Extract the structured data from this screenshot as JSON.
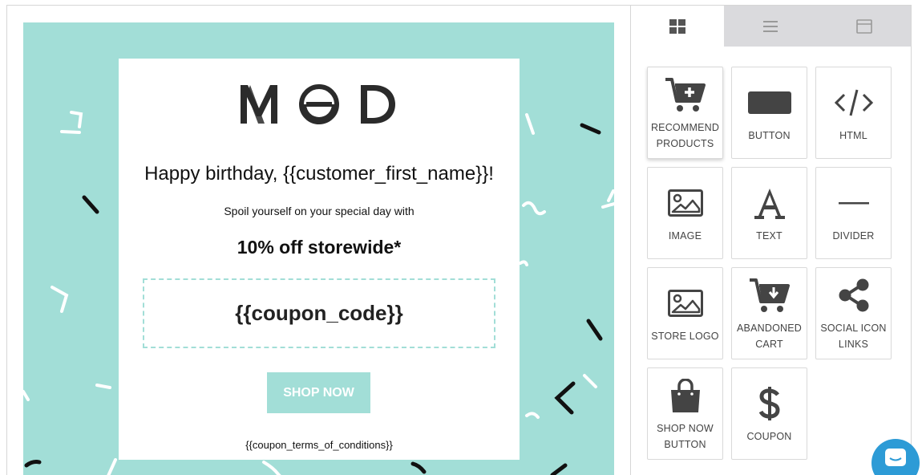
{
  "email": {
    "logo_text": "MOD",
    "headline": "Happy birthday, {{customer_first_name}}!",
    "subtext": "Spoil yourself on your special day with",
    "offer": "10% off storewide*",
    "coupon_code": "{{coupon_code}}",
    "shop_button": "SHOP NOW",
    "terms": "{{coupon_terms_of_conditions}}"
  },
  "colors": {
    "accent": "#a2ded7",
    "tab_inactive": "#dadadd",
    "icon": "#444444",
    "chat": "#2d9bd6"
  },
  "panel": {
    "tabs": [
      {
        "icon": "grid-icon"
      },
      {
        "icon": "list-icon"
      },
      {
        "icon": "layout-icon"
      }
    ],
    "blocks": [
      {
        "label": "RECOMMEND PRODUCTS",
        "icon": "cart-plus-icon"
      },
      {
        "label": "BUTTON",
        "icon": "button-icon"
      },
      {
        "label": "HTML",
        "icon": "code-icon"
      },
      {
        "label": "IMAGE",
        "icon": "image-icon"
      },
      {
        "label": "TEXT",
        "icon": "text-icon"
      },
      {
        "label": "DIVIDER",
        "icon": "divider-icon"
      },
      {
        "label": "STORE LOGO",
        "icon": "image-icon"
      },
      {
        "label": "ABANDONED CART",
        "icon": "cart-download-icon"
      },
      {
        "label": "SOCIAL ICON LINKS",
        "icon": "share-icon"
      },
      {
        "label": "SHOP NOW BUTTON",
        "icon": "shopping-bag-icon"
      },
      {
        "label": "COUPON",
        "icon": "dollar-icon"
      }
    ]
  }
}
